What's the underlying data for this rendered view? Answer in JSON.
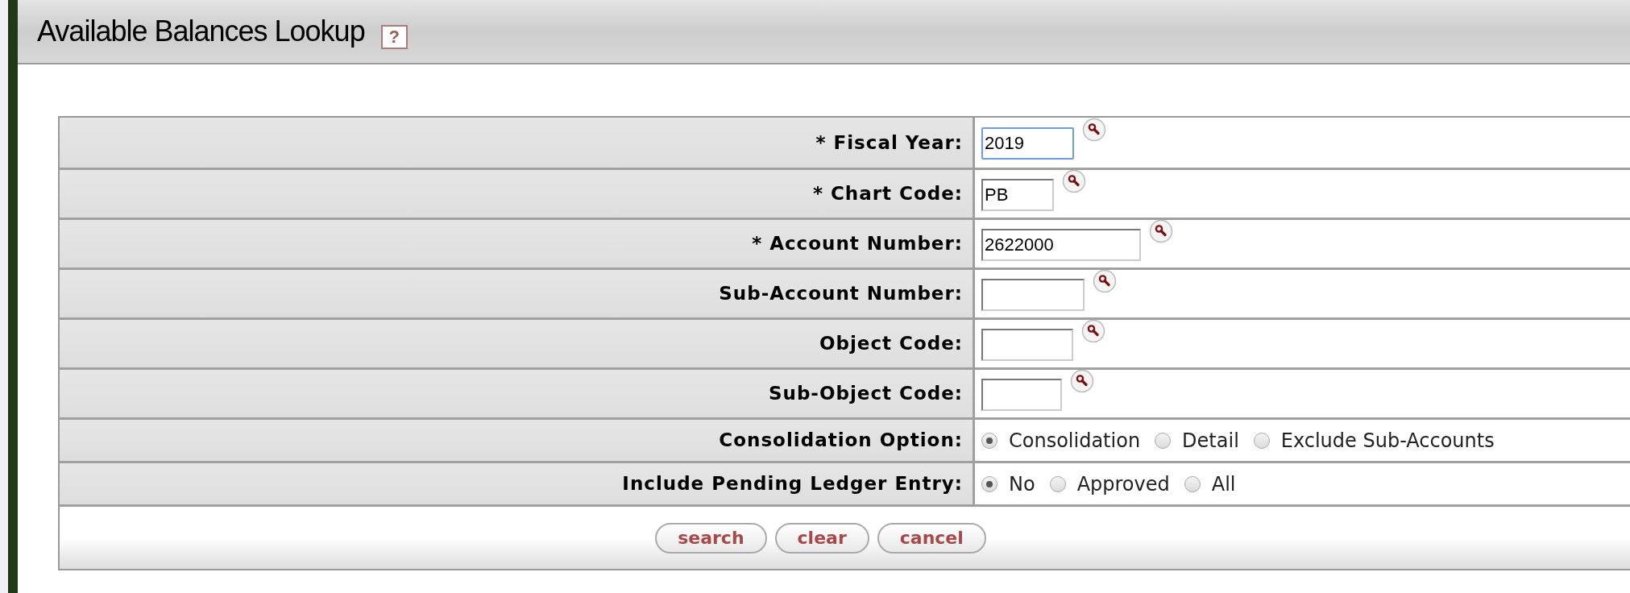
{
  "header": {
    "title": "Available Balances Lookup",
    "help": "?"
  },
  "fields": [
    {
      "kind": "text",
      "label": "* Fiscal Year:",
      "value": "2019",
      "focused": true
    },
    {
      "kind": "text",
      "label": "* Chart Code:",
      "value": "PB",
      "focused": false
    },
    {
      "kind": "text",
      "label": "* Account Number:",
      "value": "2622000",
      "focused": false
    },
    {
      "kind": "text",
      "label": "Sub-Account Number:",
      "focused": false
    },
    {
      "kind": "text",
      "label": "Object Code:",
      "focused": false
    },
    {
      "kind": "text",
      "label": "Sub-Object Code:",
      "focused": false
    },
    {
      "kind": "radio",
      "label": "Consolidation Option:",
      "options": [
        {
          "label": "Consolidation",
          "selected": true
        },
        {
          "label": "Detail",
          "selected": false
        },
        {
          "label": "Exclude Sub-Accounts",
          "selected": false
        }
      ]
    },
    {
      "kind": "radio",
      "label": "Include Pending Ledger Entry:",
      "options": [
        {
          "label": "No",
          "selected": true
        },
        {
          "label": "Approved",
          "selected": false
        },
        {
          "label": "All",
          "selected": false
        }
      ]
    }
  ],
  "buttons": [
    "search",
    "clear",
    "cancel"
  ]
}
